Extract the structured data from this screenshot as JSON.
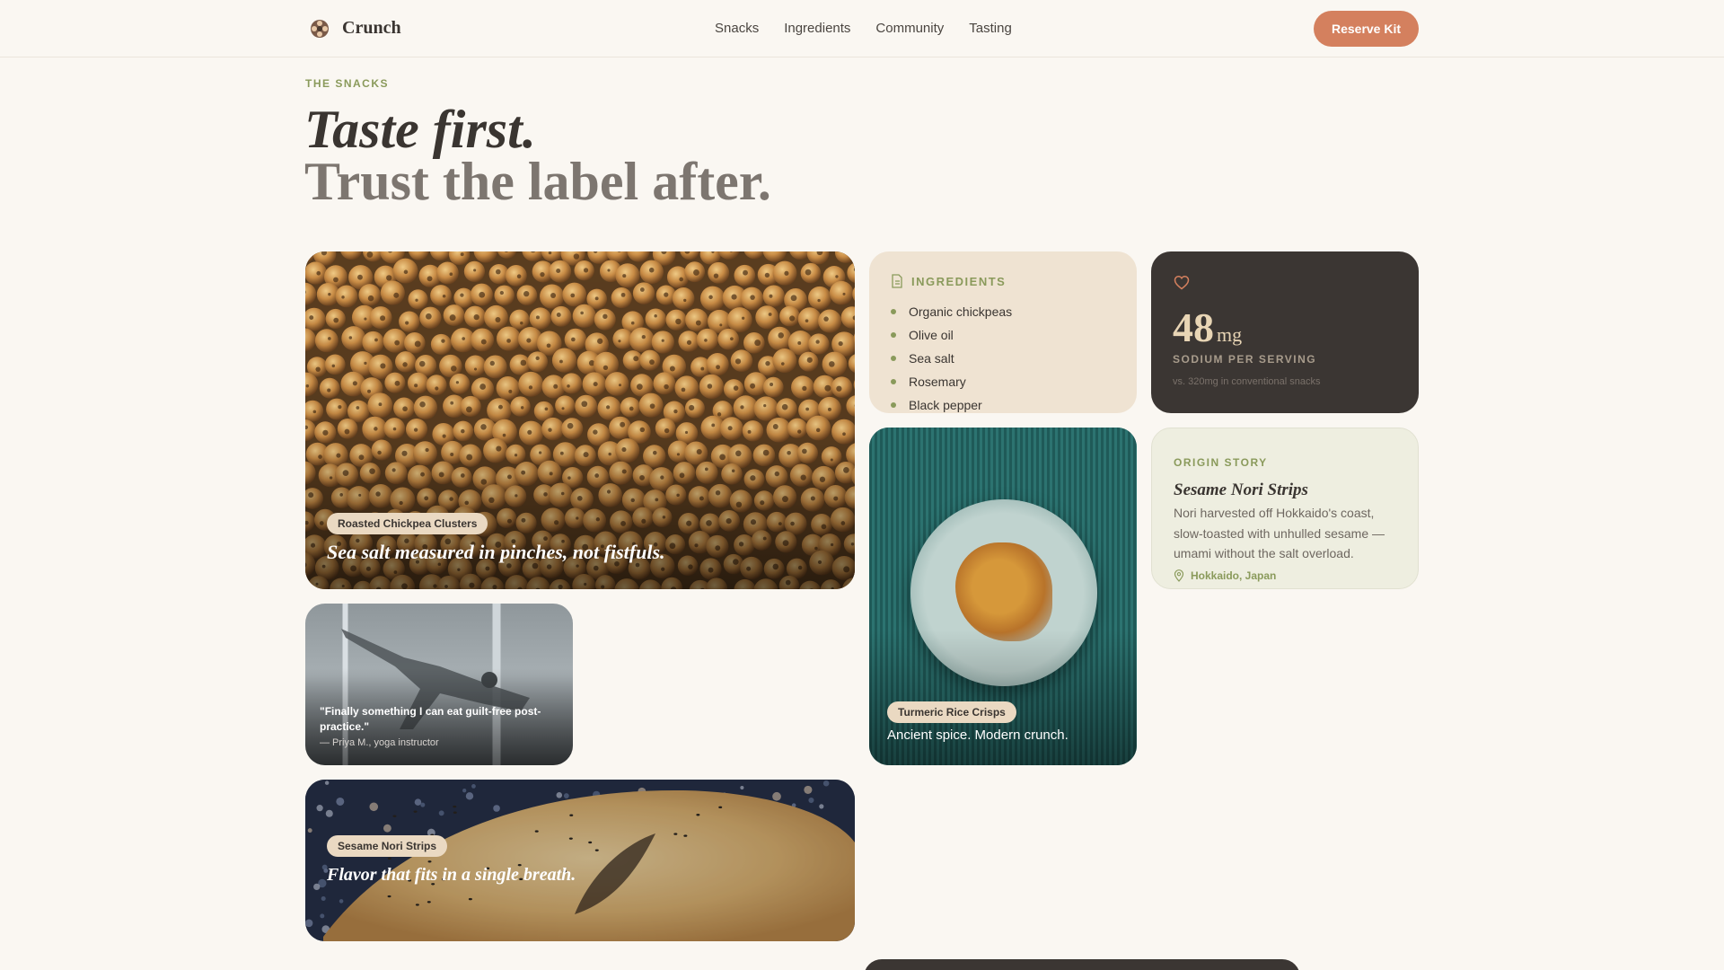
{
  "nav": {
    "brand": "Crunch",
    "links": [
      "Snacks",
      "Ingredients",
      "Community",
      "Tasting"
    ],
    "cta": "Reserve Kit"
  },
  "hero": {
    "eyebrow": "THE SNACKS",
    "headline_1": "Taste first.",
    "headline_2": "Trust the label after."
  },
  "cards": {
    "chickpea": {
      "pill": "Roasted Chickpea Clusters",
      "caption": "Sea salt measured in pinches, not fistfuls."
    },
    "ingredients": {
      "title": "INGREDIENTS",
      "items": [
        "Organic chickpeas",
        "Olive oil",
        "Sea salt",
        "Rosemary",
        "Black pepper"
      ]
    },
    "sodium": {
      "value": "48",
      "unit": "mg",
      "label": "SODIUM PER SERVING",
      "note": "vs. 320mg in conventional snacks"
    },
    "turmeric": {
      "pill": "Turmeric Rice Crisps",
      "caption": "Ancient spice. Modern crunch."
    },
    "origin": {
      "label": "ORIGIN STORY",
      "title": "Sesame Nori Strips",
      "body": "Nori harvested off Hokkaido's coast, slow-toasted with unhulled sesame — umami without the salt overload.",
      "location": "Hokkaido, Japan"
    },
    "testimonial": {
      "quote": "\"Finally something I can eat guilt-free post-practice.\"",
      "author": "— Priya M., yoga instructor"
    },
    "bread": {
      "pill": "Sesame Nori Strips",
      "caption": "Flavor that fits in a single breath."
    }
  },
  "icons": {
    "brand": "flower-logo-icon",
    "ingredients": "document-icon",
    "sodium": "heart-icon",
    "origin": "map-pin-icon"
  },
  "colors": {
    "accent": "#d4805e",
    "green": "#8a9a5b",
    "dark": "#3b3633",
    "background": "#faf7f2"
  }
}
